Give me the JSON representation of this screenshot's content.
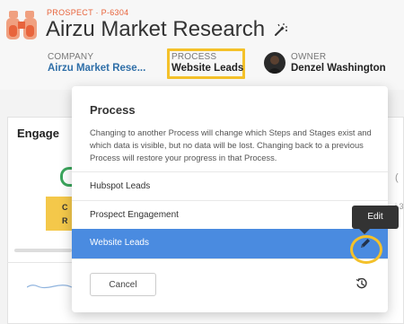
{
  "header": {
    "prospect_id": "PROSPECT · P-6304",
    "title": "Airzu Market Research",
    "company_label": "COMPANY",
    "company_value": "Airzu Market Rese...",
    "process_label": "PROCESS",
    "process_value": "Website Leads",
    "owner_label": "OWNER",
    "owner_value": "Denzel Washington",
    "icons": [
      "binoculars-icon",
      "magic-wand-icon",
      "avatar"
    ]
  },
  "background": {
    "section_title": "Engage",
    "card_text_1": "C",
    "card_text_2": "R",
    "right_text_1": "(",
    "right_text_2": "i 3"
  },
  "modal": {
    "title": "Process",
    "description": "Changing to another Process will change which Steps and Stages exist and which data is visible, but no data will be lost. Changing back to a previous Process will restore your progress in that Process.",
    "options": [
      {
        "label": "Hubspot Leads",
        "selected": false
      },
      {
        "label": "Prospect Engagement",
        "selected": false
      },
      {
        "label": "Website Leads",
        "selected": true
      }
    ],
    "tooltip": "Edit",
    "cancel_label": "Cancel",
    "icons": [
      "pencil-icon",
      "history-icon"
    ]
  },
  "colors": {
    "accent_orange": "#e8643c",
    "link_blue": "#2f6fa8",
    "selected_blue": "#4a8be0",
    "highlight_yellow": "#f4c12a"
  }
}
